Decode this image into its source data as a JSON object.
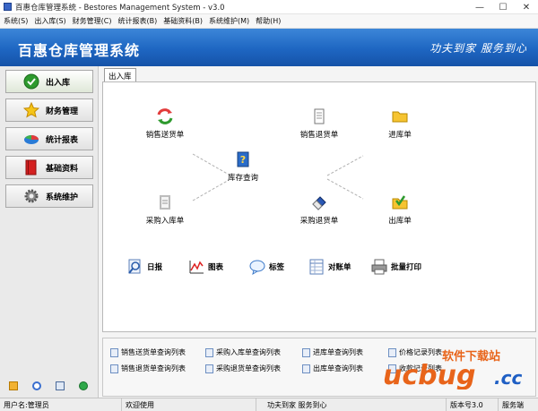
{
  "window": {
    "title": "百惠仓库管理系统 - Bestores Management System - v3.0",
    "minimize": "—",
    "maximize": "☐",
    "close": "✕"
  },
  "menu": [
    "系统(S)",
    "出入库(S)",
    "财务管理(C)",
    "统计报表(B)",
    "基础资料(B)",
    "系统维护(M)",
    "帮助(H)"
  ],
  "banner": {
    "app_name": "百惠仓库管理系统",
    "slogan": "功夫到家  服务到心"
  },
  "sidebar": {
    "items": [
      {
        "label": "出入库",
        "icon": "check-circle-icon"
      },
      {
        "label": "财务管理",
        "icon": "star-icon"
      },
      {
        "label": "统计报表",
        "icon": "pie-chart-icon"
      },
      {
        "label": "基础资料",
        "icon": "book-icon"
      },
      {
        "label": "系统维护",
        "icon": "gear-icon"
      }
    ]
  },
  "tab": {
    "label": "出入库"
  },
  "flow": {
    "sales_delivery": "销售送货单",
    "sales_return": "销售退货单",
    "stock_in": "进库单",
    "inventory_query": "库存查询",
    "purchase_in": "采购入库单",
    "purchase_return": "采购退货单",
    "stock_out": "出库单"
  },
  "tools": {
    "daily": "日报",
    "chart": "图表",
    "tag": "标签",
    "reconcile": "对账单",
    "batch_print": "批量打印"
  },
  "reports": {
    "row1": [
      "销售送货单查询列表",
      "采购入库单查询列表",
      "进库单查询列表",
      "价格记录列表"
    ],
    "row2": [
      "销售退货单查询列表",
      "采购退货单查询列表",
      "出库单查询列表",
      "收款记录列表"
    ]
  },
  "watermark": {
    "text": "软件下载站",
    "brand": "ucbug",
    "suffix": ".cc"
  },
  "statusbar": {
    "user": "用户名:管理员",
    "welcome": "欢迎使用",
    "slogan": "功夫到家 服务到心",
    "version": "版本号3.0",
    "service": "服务端"
  }
}
